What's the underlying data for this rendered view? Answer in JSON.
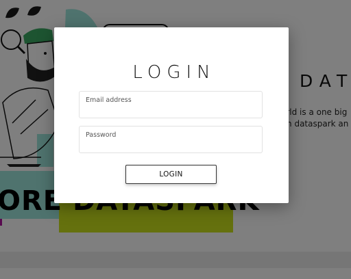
{
  "background": {
    "banner_text": "ORE DATASPARK",
    "right_title": "DAT",
    "right_text": [
      "orld is a one big",
      "ith dataspark an"
    ]
  },
  "modal": {
    "title": "LOGIN",
    "email": {
      "label": "Email address",
      "value": ""
    },
    "password": {
      "label": "Password",
      "value": ""
    },
    "submit_label": "LOGIN"
  },
  "colors": {
    "banner_mint": "#9ee7dc",
    "banner_olive": "#cbe21c",
    "accent_magenta": "#b0129e",
    "overlay": "rgba(0,0,0,0.5)"
  },
  "icons": [
    "magnifier-icon",
    "leaf-icon"
  ]
}
